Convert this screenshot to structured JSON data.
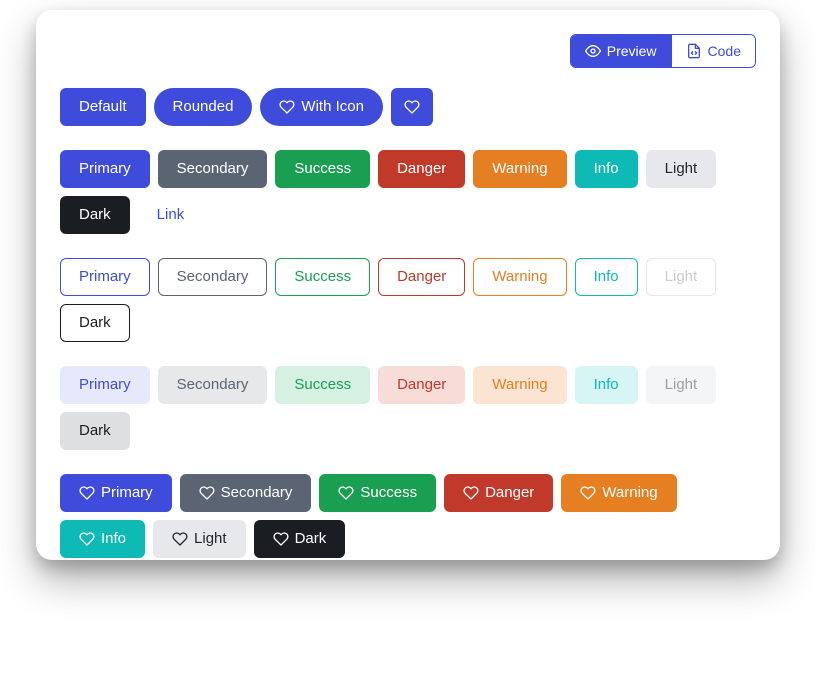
{
  "header": {
    "preview_label": "Preview",
    "code_label": "Code"
  },
  "row1": {
    "default": "Default",
    "rounded": "Rounded",
    "with_icon": "With Icon"
  },
  "variants": {
    "primary": "Primary",
    "secondary": "Secondary",
    "success": "Success",
    "danger": "Danger",
    "warning": "Warning",
    "info": "Info",
    "light": "Light",
    "dark": "Dark",
    "link": "Link"
  }
}
